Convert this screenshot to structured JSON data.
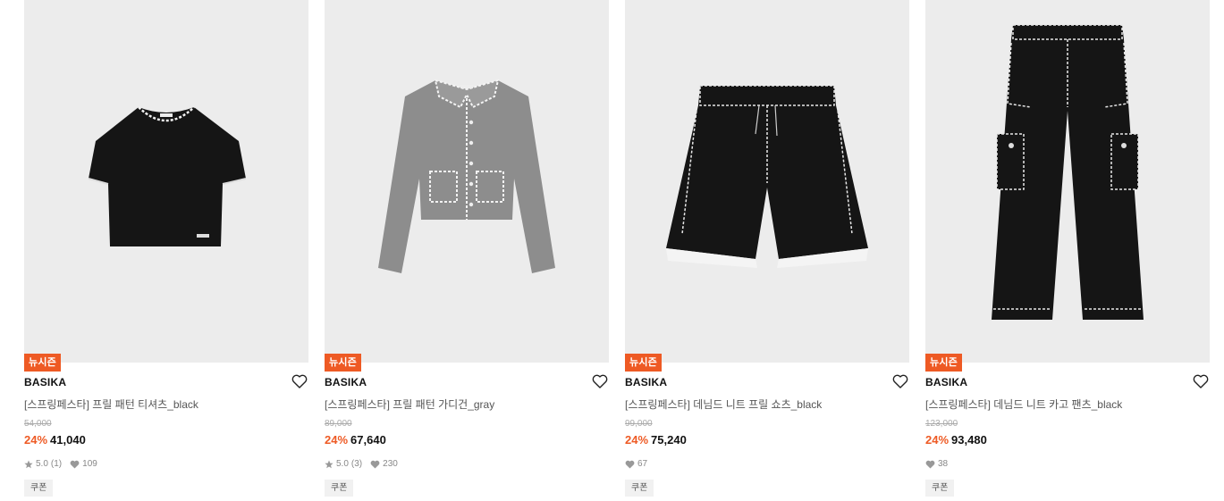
{
  "products": [
    {
      "badge": "뉴시즌",
      "brand": "BASIKA",
      "name": "[스프링페스타] 프릴 패턴 티셔츠_black",
      "original_price": "54,000",
      "discount": "24%",
      "price": "41,040",
      "rating": "5.0",
      "reviews": "(1)",
      "likes": "109",
      "coupon": "쿠폰",
      "image_icon": "black-tshirt-image"
    },
    {
      "badge": "뉴시즌",
      "brand": "BASIKA",
      "name": "[스프링페스타] 프릴 패턴 가디건_gray",
      "original_price": "89,000",
      "discount": "24%",
      "price": "67,640",
      "rating": "5.0",
      "reviews": "(3)",
      "likes": "230",
      "coupon": "쿠폰",
      "image_icon": "gray-cardigan-image"
    },
    {
      "badge": "뉴시즌",
      "brand": "BASIKA",
      "name": "[스프링페스타] 데님드 니트 프릴 쇼츠_black",
      "original_price": "99,000",
      "discount": "24%",
      "price": "75,240",
      "likes": "67",
      "coupon": "쿠폰",
      "image_icon": "black-shorts-image"
    },
    {
      "badge": "뉴시즌",
      "brand": "BASIKA",
      "name": "[스프링페스타] 데님드 니트 카고 팬츠_black",
      "original_price": "123,000",
      "discount": "24%",
      "price": "93,480",
      "likes": "38",
      "coupon": "쿠폰",
      "image_icon": "black-cargo-pants-image"
    }
  ],
  "colors": {
    "accent": "#ee5a24",
    "image_bg": "#ececec",
    "garment_black": "#151515",
    "garment_gray": "#8a8a8a"
  },
  "icons": {
    "wishlist": "heart-outline-icon",
    "rating": "star-icon",
    "likes": "heart-filled-icon"
  }
}
